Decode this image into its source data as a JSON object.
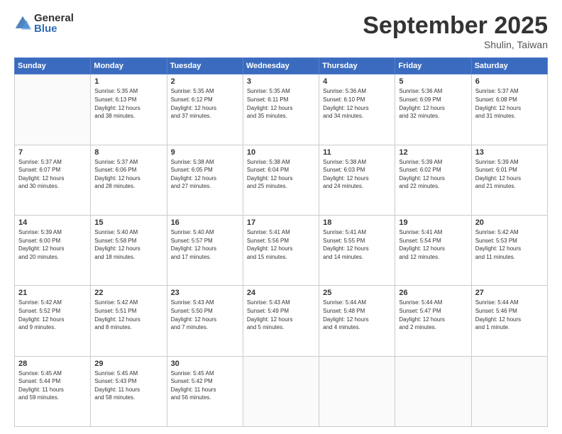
{
  "logo": {
    "general": "General",
    "blue": "Blue"
  },
  "header": {
    "month": "September 2025",
    "location": "Shulin, Taiwan"
  },
  "weekdays": [
    "Sunday",
    "Monday",
    "Tuesday",
    "Wednesday",
    "Thursday",
    "Friday",
    "Saturday"
  ],
  "weeks": [
    [
      {
        "day": "",
        "info": ""
      },
      {
        "day": "1",
        "info": "Sunrise: 5:35 AM\nSunset: 6:13 PM\nDaylight: 12 hours\nand 38 minutes."
      },
      {
        "day": "2",
        "info": "Sunrise: 5:35 AM\nSunset: 6:12 PM\nDaylight: 12 hours\nand 37 minutes."
      },
      {
        "day": "3",
        "info": "Sunrise: 5:35 AM\nSunset: 6:11 PM\nDaylight: 12 hours\nand 35 minutes."
      },
      {
        "day": "4",
        "info": "Sunrise: 5:36 AM\nSunset: 6:10 PM\nDaylight: 12 hours\nand 34 minutes."
      },
      {
        "day": "5",
        "info": "Sunrise: 5:36 AM\nSunset: 6:09 PM\nDaylight: 12 hours\nand 32 minutes."
      },
      {
        "day": "6",
        "info": "Sunrise: 5:37 AM\nSunset: 6:08 PM\nDaylight: 12 hours\nand 31 minutes."
      }
    ],
    [
      {
        "day": "7",
        "info": "Sunrise: 5:37 AM\nSunset: 6:07 PM\nDaylight: 12 hours\nand 30 minutes."
      },
      {
        "day": "8",
        "info": "Sunrise: 5:37 AM\nSunset: 6:06 PM\nDaylight: 12 hours\nand 28 minutes."
      },
      {
        "day": "9",
        "info": "Sunrise: 5:38 AM\nSunset: 6:05 PM\nDaylight: 12 hours\nand 27 minutes."
      },
      {
        "day": "10",
        "info": "Sunrise: 5:38 AM\nSunset: 6:04 PM\nDaylight: 12 hours\nand 25 minutes."
      },
      {
        "day": "11",
        "info": "Sunrise: 5:38 AM\nSunset: 6:03 PM\nDaylight: 12 hours\nand 24 minutes."
      },
      {
        "day": "12",
        "info": "Sunrise: 5:39 AM\nSunset: 6:02 PM\nDaylight: 12 hours\nand 22 minutes."
      },
      {
        "day": "13",
        "info": "Sunrise: 5:39 AM\nSunset: 6:01 PM\nDaylight: 12 hours\nand 21 minutes."
      }
    ],
    [
      {
        "day": "14",
        "info": "Sunrise: 5:39 AM\nSunset: 6:00 PM\nDaylight: 12 hours\nand 20 minutes."
      },
      {
        "day": "15",
        "info": "Sunrise: 5:40 AM\nSunset: 5:58 PM\nDaylight: 12 hours\nand 18 minutes."
      },
      {
        "day": "16",
        "info": "Sunrise: 5:40 AM\nSunset: 5:57 PM\nDaylight: 12 hours\nand 17 minutes."
      },
      {
        "day": "17",
        "info": "Sunrise: 5:41 AM\nSunset: 5:56 PM\nDaylight: 12 hours\nand 15 minutes."
      },
      {
        "day": "18",
        "info": "Sunrise: 5:41 AM\nSunset: 5:55 PM\nDaylight: 12 hours\nand 14 minutes."
      },
      {
        "day": "19",
        "info": "Sunrise: 5:41 AM\nSunset: 5:54 PM\nDaylight: 12 hours\nand 12 minutes."
      },
      {
        "day": "20",
        "info": "Sunrise: 5:42 AM\nSunset: 5:53 PM\nDaylight: 12 hours\nand 11 minutes."
      }
    ],
    [
      {
        "day": "21",
        "info": "Sunrise: 5:42 AM\nSunset: 5:52 PM\nDaylight: 12 hours\nand 9 minutes."
      },
      {
        "day": "22",
        "info": "Sunrise: 5:42 AM\nSunset: 5:51 PM\nDaylight: 12 hours\nand 8 minutes."
      },
      {
        "day": "23",
        "info": "Sunrise: 5:43 AM\nSunset: 5:50 PM\nDaylight: 12 hours\nand 7 minutes."
      },
      {
        "day": "24",
        "info": "Sunrise: 5:43 AM\nSunset: 5:49 PM\nDaylight: 12 hours\nand 5 minutes."
      },
      {
        "day": "25",
        "info": "Sunrise: 5:44 AM\nSunset: 5:48 PM\nDaylight: 12 hours\nand 4 minutes."
      },
      {
        "day": "26",
        "info": "Sunrise: 5:44 AM\nSunset: 5:47 PM\nDaylight: 12 hours\nand 2 minutes."
      },
      {
        "day": "27",
        "info": "Sunrise: 5:44 AM\nSunset: 5:46 PM\nDaylight: 12 hours\nand 1 minute."
      }
    ],
    [
      {
        "day": "28",
        "info": "Sunrise: 5:45 AM\nSunset: 5:44 PM\nDaylight: 11 hours\nand 59 minutes."
      },
      {
        "day": "29",
        "info": "Sunrise: 5:45 AM\nSunset: 5:43 PM\nDaylight: 11 hours\nand 58 minutes."
      },
      {
        "day": "30",
        "info": "Sunrise: 5:45 AM\nSunset: 5:42 PM\nDaylight: 11 hours\nand 56 minutes."
      },
      {
        "day": "",
        "info": ""
      },
      {
        "day": "",
        "info": ""
      },
      {
        "day": "",
        "info": ""
      },
      {
        "day": "",
        "info": ""
      }
    ]
  ]
}
